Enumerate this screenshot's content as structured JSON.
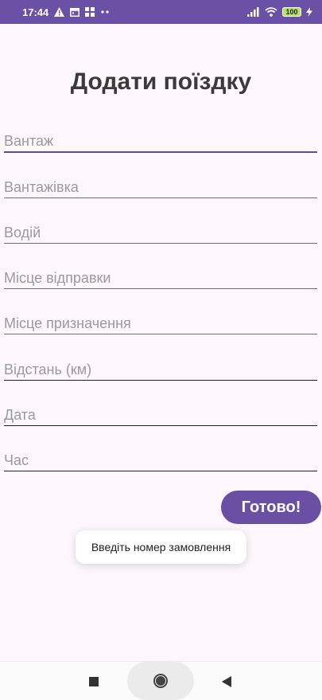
{
  "status_bar": {
    "time": "17:44",
    "battery": "100",
    "bg_color": "#6a51a6",
    "left_icons": [
      "warning-icon",
      "calendar-icon",
      "gallery-icon",
      "more-dots-icon"
    ],
    "right_icons": [
      "signal-icon",
      "wifi-icon",
      "battery-icon",
      "charging-icon"
    ]
  },
  "page": {
    "title": "Додати поїздку"
  },
  "form": {
    "cargo_placeholder": "Вантаж",
    "truck_placeholder": "Вантажівка",
    "driver_placeholder": "Водій",
    "departure_placeholder": "Місце відправки",
    "destination_placeholder": "Місце призначення",
    "distance_placeholder": "Відстань (км)",
    "date_placeholder": "Дата",
    "time_placeholder": "Час",
    "submit_label": "Готово!",
    "accent_color": "#6a4fa5"
  },
  "toast": {
    "message": "Введіть номер замовлення"
  },
  "nav_bar": {
    "icons": [
      "recents-icon",
      "home-icon",
      "back-icon"
    ]
  }
}
